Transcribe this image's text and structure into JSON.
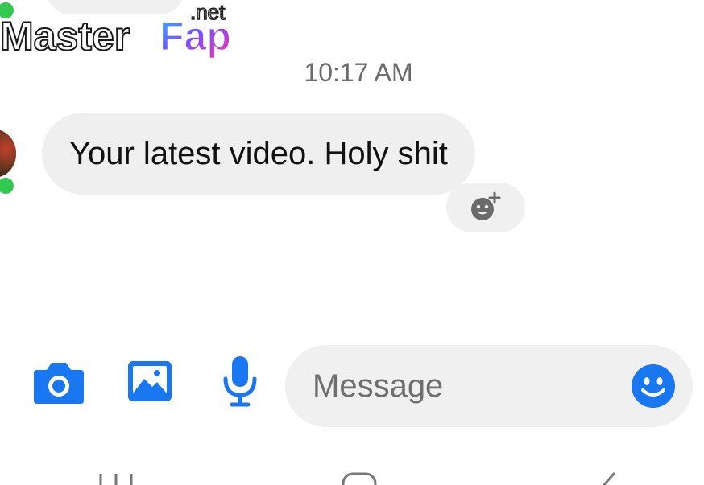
{
  "watermark": {
    "text_main": "Master",
    "text_accent": "Fap",
    "text_suffix": ".net"
  },
  "conversation": {
    "timestamp": "10:17 AM",
    "messages": [
      {
        "text": "Your latest video. Holy shit",
        "sender": "contact"
      }
    ]
  },
  "composer": {
    "placeholder": "Message",
    "icons": [
      "camera-icon",
      "image-icon",
      "microphone-icon",
      "emoji-icon"
    ]
  },
  "colors": {
    "accent": "#1a77f2",
    "bubble": "#efefef",
    "presence": "#31c950",
    "timestamp": "#6b6b6b"
  }
}
